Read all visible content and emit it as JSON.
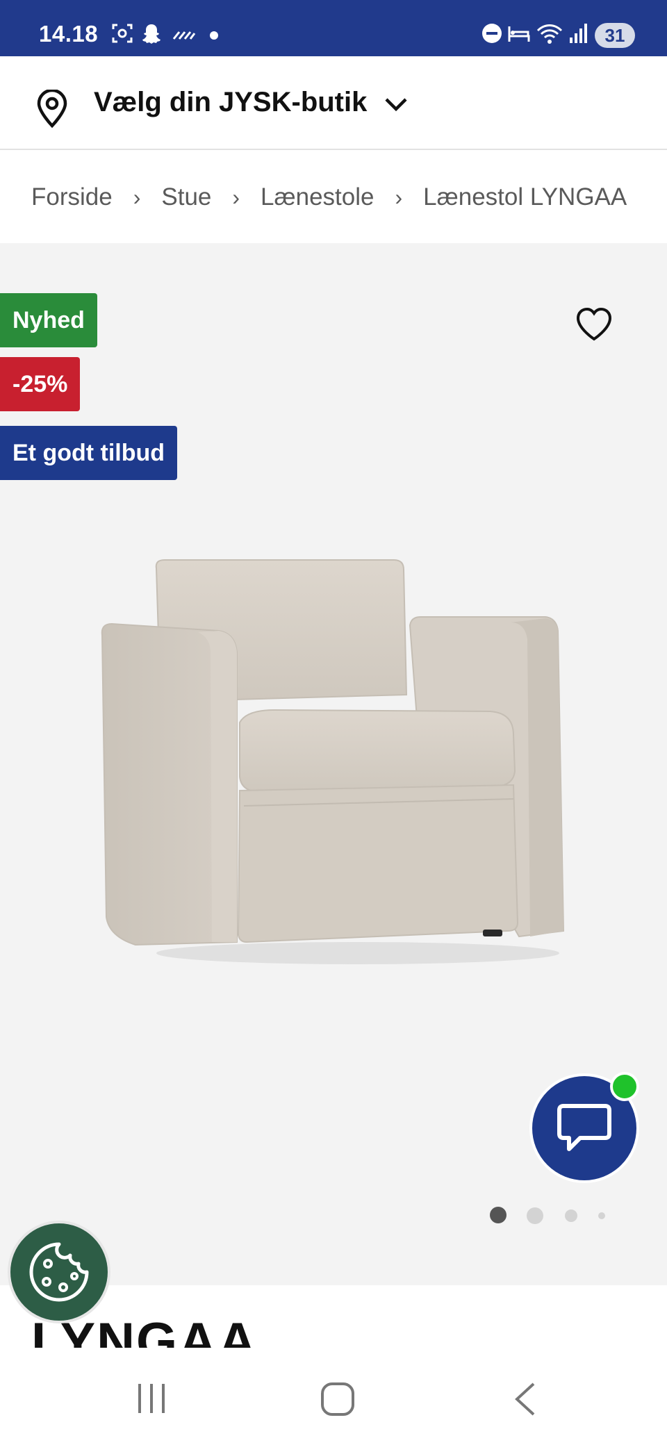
{
  "status_bar": {
    "time": "14.18",
    "battery": "31"
  },
  "store_selector": {
    "label": "Vælg din JYSK-butik"
  },
  "breadcrumb": {
    "items": [
      "Forside",
      "Stue",
      "Lænestole",
      "Lænestol LYNGAA"
    ]
  },
  "badges": {
    "new": "Nyhed",
    "discount": "-25%",
    "offer": "Et godt tilbud"
  },
  "gallery": {
    "image_count": 4,
    "active_index": 0
  },
  "product": {
    "title": "LYNGAA"
  },
  "colors": {
    "brand_blue": "#1e3a8c",
    "status_blue": "#213a8c",
    "new_green": "#2a8c3a",
    "discount_red": "#c8202f",
    "cookie_green": "#2d5d46"
  }
}
